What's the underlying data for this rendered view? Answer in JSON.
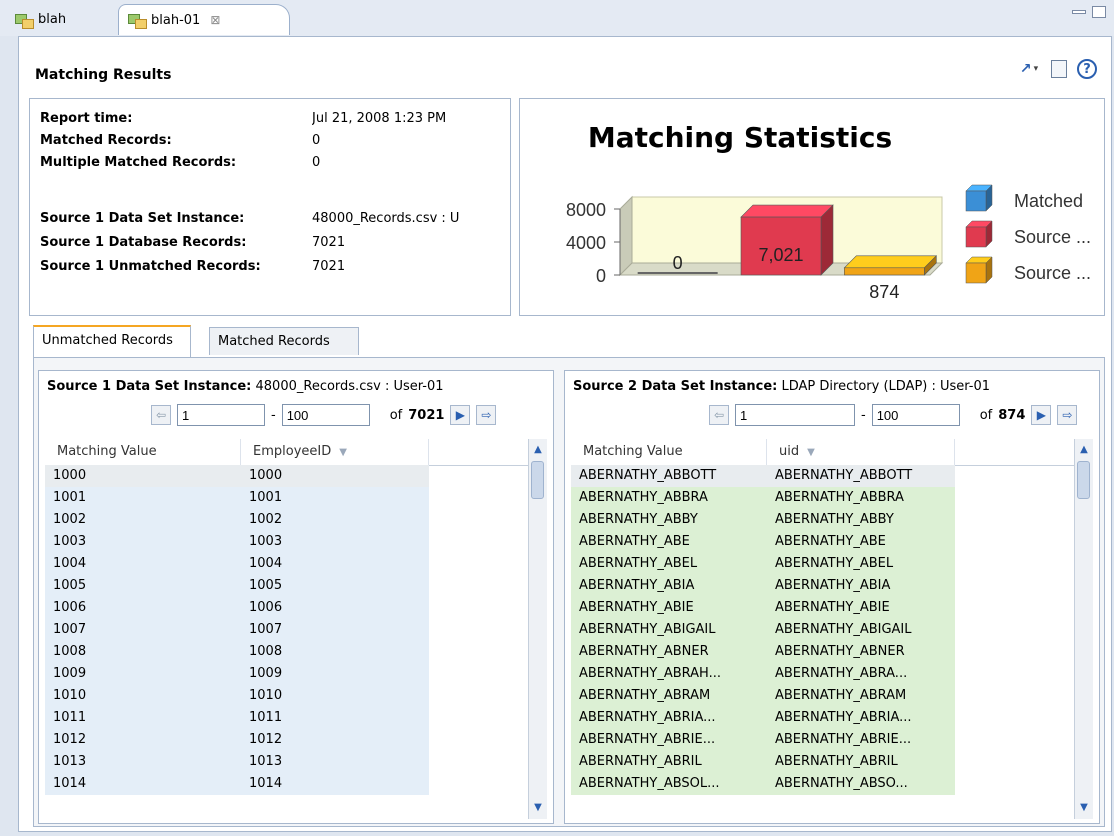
{
  "editor_tabs": [
    {
      "label": "blah"
    },
    {
      "label": "blah-01",
      "close": "⊠"
    }
  ],
  "section_title": "Matching Results",
  "info": {
    "report_time_label": "Report time:",
    "report_time_value": "Jul 21, 2008 1:23 PM",
    "matched_label": "Matched Records:",
    "matched_value": "0",
    "multi_label": "Multiple Matched Records:",
    "multi_value": "0",
    "src1_instance_label": "Source 1 Data Set Instance:",
    "src1_instance_value": "48000_Records.csv : U",
    "src1_db_label": "Source 1 Database Records:",
    "src1_db_value": "7021",
    "src1_unmatched_label": "Source 1 Unmatched Records:",
    "src1_unmatched_value": "7021"
  },
  "chart_data": {
    "type": "bar",
    "title": "Matching Statistics",
    "categories": [
      "Matched",
      "Source ...",
      "Source ..."
    ],
    "values": [
      0,
      7021,
      874
    ],
    "data_labels": [
      "0",
      "7,021",
      "874"
    ],
    "ylim": [
      0,
      8000
    ],
    "yticks": [
      "0",
      "4000",
      "8000"
    ],
    "legend": [
      {
        "name": "Matched",
        "color": "#3b8fd6"
      },
      {
        "name": "Source ...",
        "color": "#e03a4f"
      },
      {
        "name": "Source ...",
        "color": "#f0a416"
      }
    ],
    "legend_position": "right",
    "three_d": true
  },
  "result_tabs": {
    "unmatched": "Unmatched Records",
    "matched": "Matched Records"
  },
  "source1": {
    "label": "Source 1 Data Set Instance:",
    "value": "48000_Records.csv : User-01",
    "from": "1",
    "to": "100",
    "of_label": "of",
    "total": "7021",
    "col1": "Matching Value",
    "col2": "EmployeeID",
    "rows": [
      [
        "1000",
        "1000"
      ],
      [
        "1001",
        "1001"
      ],
      [
        "1002",
        "1002"
      ],
      [
        "1003",
        "1003"
      ],
      [
        "1004",
        "1004"
      ],
      [
        "1005",
        "1005"
      ],
      [
        "1006",
        "1006"
      ],
      [
        "1007",
        "1007"
      ],
      [
        "1008",
        "1008"
      ],
      [
        "1009",
        "1009"
      ],
      [
        "1010",
        "1010"
      ],
      [
        "1011",
        "1011"
      ],
      [
        "1012",
        "1012"
      ],
      [
        "1013",
        "1013"
      ],
      [
        "1014",
        "1014"
      ]
    ]
  },
  "source2": {
    "label": "Source 2 Data Set Instance:",
    "value": "LDAP Directory (LDAP) : User-01",
    "from": "1",
    "to": "100",
    "of_label": "of",
    "total": "874",
    "col1": "Matching Value",
    "col2": "uid",
    "rows": [
      [
        "ABERNATHY_ABBOTT",
        "ABERNATHY_ABBOTT"
      ],
      [
        "ABERNATHY_ABBRA",
        "ABERNATHY_ABBRA"
      ],
      [
        "ABERNATHY_ABBY",
        "ABERNATHY_ABBY"
      ],
      [
        "ABERNATHY_ABE",
        "ABERNATHY_ABE"
      ],
      [
        "ABERNATHY_ABEL",
        "ABERNATHY_ABEL"
      ],
      [
        "ABERNATHY_ABIA",
        "ABERNATHY_ABIA"
      ],
      [
        "ABERNATHY_ABIE",
        "ABERNATHY_ABIE"
      ],
      [
        "ABERNATHY_ABIGAIL",
        "ABERNATHY_ABIGAIL"
      ],
      [
        "ABERNATHY_ABNER",
        "ABERNATHY_ABNER"
      ],
      [
        "ABERNATHY_ABRAH...",
        "ABERNATHY_ABRA..."
      ],
      [
        "ABERNATHY_ABRAM",
        "ABERNATHY_ABRAM"
      ],
      [
        "ABERNATHY_ABRIA...",
        "ABERNATHY_ABRIA..."
      ],
      [
        "ABERNATHY_ABRIE...",
        "ABERNATHY_ABRIE..."
      ],
      [
        "ABERNATHY_ABRIL",
        "ABERNATHY_ABRIL"
      ],
      [
        "ABERNATHY_ABSOL...",
        "ABERNATHY_ABSO..."
      ]
    ]
  }
}
